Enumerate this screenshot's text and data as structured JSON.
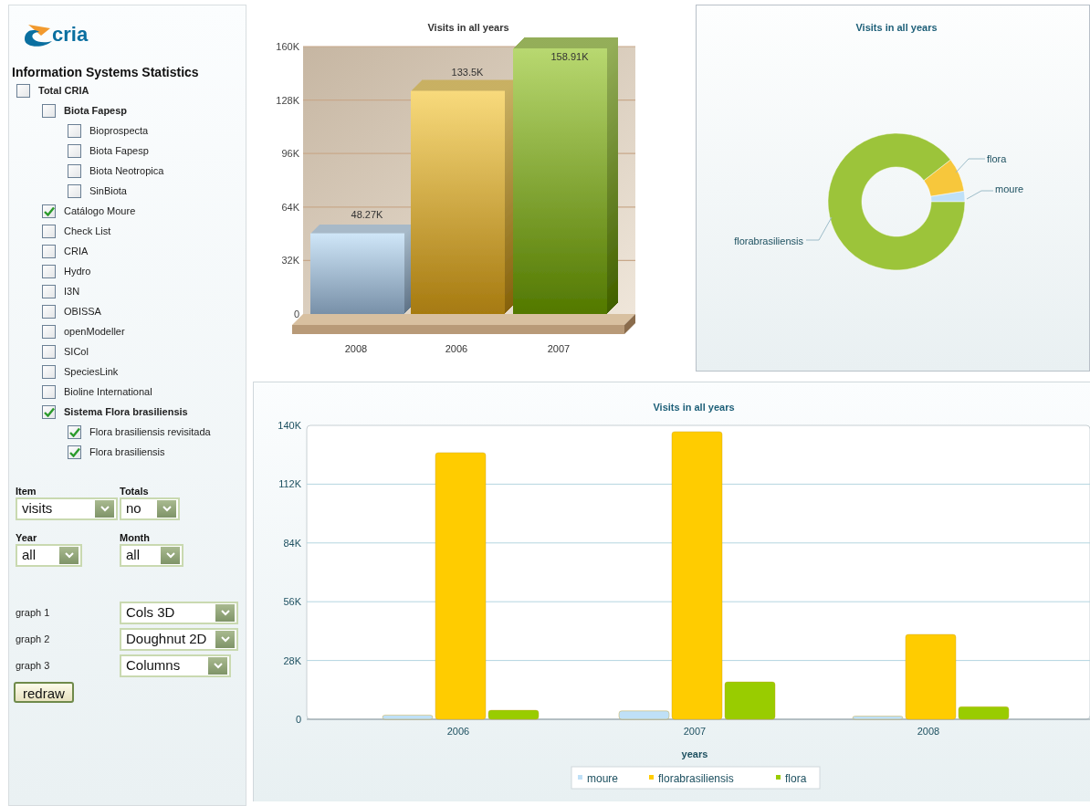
{
  "logo": {
    "text": "cria"
  },
  "sidebar": {
    "title": "Information Systems Statistics",
    "tree": [
      {
        "label": "Total CRIA",
        "checked": false,
        "children": [
          {
            "label": "Biota Fapesp",
            "checked": false,
            "children": [
              {
                "label": "Bioprospecta",
                "checked": false
              },
              {
                "label": "Biota Fapesp",
                "checked": false
              },
              {
                "label": "Biota Neotropica",
                "checked": false
              },
              {
                "label": "SinBiota",
                "checked": false
              }
            ]
          },
          {
            "label": "Catálogo Moure",
            "checked": true
          },
          {
            "label": "Check List",
            "checked": false
          },
          {
            "label": "CRIA",
            "checked": false
          },
          {
            "label": "Hydro",
            "checked": false
          },
          {
            "label": "I3N",
            "checked": false
          },
          {
            "label": "OBISSA",
            "checked": false
          },
          {
            "label": "openModeller",
            "checked": false
          },
          {
            "label": "SICol",
            "checked": false
          },
          {
            "label": "SpeciesLink",
            "checked": false
          },
          {
            "label": "Bioline International",
            "checked": false
          },
          {
            "label": "Sistema Flora brasiliensis",
            "checked": true,
            "children": [
              {
                "label": "Flora brasiliensis revisitada",
                "checked": true
              },
              {
                "label": "Flora brasiliensis",
                "checked": true
              }
            ]
          }
        ]
      }
    ]
  },
  "filters": [
    {
      "label": "Item",
      "value": "visits"
    },
    {
      "label": "Totals",
      "value": "no"
    },
    {
      "label": "Year",
      "value": "all"
    },
    {
      "label": "Month",
      "value": "all"
    }
  ],
  "graph_selects": [
    {
      "label": "graph 1",
      "value": "Cols 3D"
    },
    {
      "label": "graph 2",
      "value": "Doughnut 2D"
    },
    {
      "label": "graph 3",
      "value": "Columns"
    }
  ],
  "redraw_button": "redraw",
  "chart1": {
    "chart_data": {
      "type": "bar",
      "title": "Visits in all years",
      "categories": [
        "2008",
        "2006",
        "2007"
      ],
      "values": [
        48270,
        133500,
        158910
      ],
      "value_labels": [
        "48.27K",
        "133.5K",
        "158.91K"
      ],
      "ylim": [
        0,
        160000
      ],
      "grid": true,
      "yticks": [
        {
          "value": 0,
          "label": "0"
        },
        {
          "value": 32000,
          "label": "32K"
        },
        {
          "value": 64000,
          "label": "64K"
        },
        {
          "value": 96000,
          "label": "96K"
        },
        {
          "value": 128000,
          "label": "128K"
        },
        {
          "value": 160000,
          "label": "160K"
        }
      ]
    }
  },
  "donut": {
    "title": "Visits in all years",
    "labels": [
      {
        "text": "flora"
      },
      {
        "text": "moure"
      },
      {
        "text": "florabrasiliensis"
      }
    ]
  },
  "chart3": {
    "chart_data": {
      "type": "bar",
      "title": "Visits in all years",
      "xlabel": "years",
      "categories": [
        "2006",
        "2007",
        "2008"
      ],
      "series": [
        {
          "name": "moure",
          "color": "#bfe0f7",
          "values": [
            2000,
            4000,
            1500
          ]
        },
        {
          "name": "florabrasiliensis",
          "color": "#ffcc00",
          "values": [
            127000,
            137000,
            40400
          ]
        },
        {
          "name": "flora",
          "color": "#99cc00",
          "values": [
            4300,
            17800,
            6000
          ]
        }
      ],
      "ylim": [
        0,
        140000
      ],
      "grid": true,
      "legend": "bottom",
      "yticks": [
        {
          "value": 0,
          "label": "0"
        },
        {
          "value": 28000,
          "label": "28K"
        },
        {
          "value": 56000,
          "label": "56K"
        },
        {
          "value": 84000,
          "label": "84K"
        },
        {
          "value": 112000,
          "label": "112K"
        },
        {
          "value": 140000,
          "label": "140K"
        }
      ]
    }
  }
}
